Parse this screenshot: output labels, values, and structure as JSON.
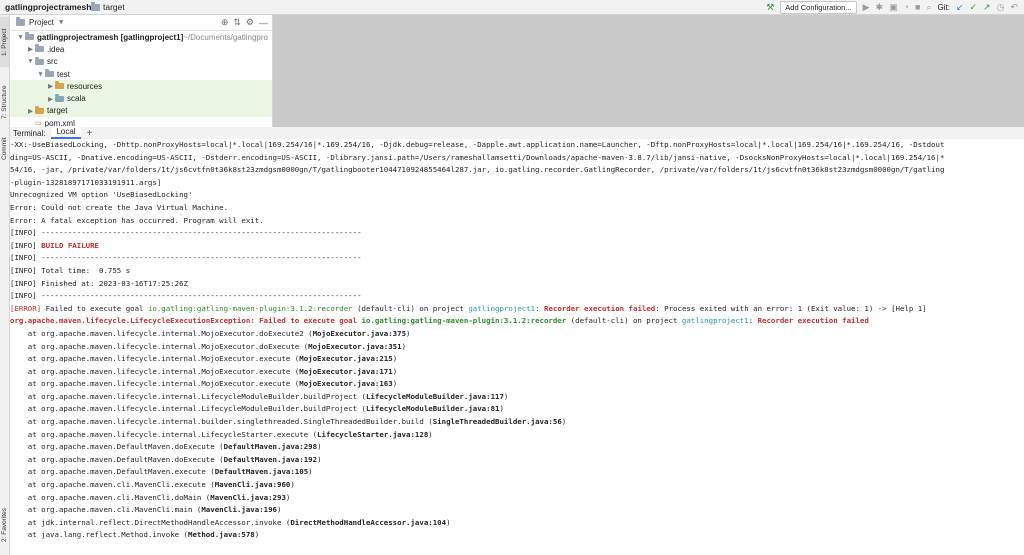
{
  "window": {
    "project_name": "gatlingprojectramesh",
    "breadcrumb_target": "target",
    "add_config_label": "Add Configuration...",
    "git_label": "Git:"
  },
  "left_strip": {
    "project_tab": "1: Project",
    "structure_tab": "7: Structure",
    "commit_tab": "Commit",
    "favorites_tab": "2: Favorites"
  },
  "project_panel": {
    "title": "Project",
    "tree": [
      {
        "label": "gatlingprojectramesh [gatlingproject1]",
        "suffix": " ~/Documents/gatlingpro",
        "indent": 0,
        "open": true,
        "kind": "gray"
      },
      {
        "label": ".idea",
        "indent": 1,
        "open": false,
        "kind": "gray"
      },
      {
        "label": "src",
        "indent": 1,
        "open": true,
        "kind": "gray"
      },
      {
        "label": "test",
        "indent": 2,
        "open": true,
        "kind": "gray"
      },
      {
        "label": "resources",
        "indent": 3,
        "open": false,
        "kind": "orange",
        "highlight": true
      },
      {
        "label": "scala",
        "indent": 3,
        "open": false,
        "kind": "teal",
        "highlight": true
      },
      {
        "label": "target",
        "indent": 1,
        "open": false,
        "kind": "orange",
        "highlight": true
      },
      {
        "label": "pom.xml",
        "indent": 1,
        "open": false,
        "kind": "none"
      }
    ]
  },
  "terminal": {
    "label": "Terminal:",
    "tab_local": "Local",
    "add_tab": "+",
    "lines": [
      {
        "text": "-XX:-UseBiasedLocking, -Dhttp.nonProxyHosts=local|*.local|169.254/16|*.169.254/16, -Djdk.debug=release, -Dapple.awt.application.name=Launcher, -Dftp.nonProxyHosts=local|*.local|169.254/16|*.169.254/16, -Dstdout"
      },
      {
        "text": "ding=US-ASCII, -Dnative.encoding=US-ASCII, -Dstderr.encoding=US-ASCII, -Dlibrary.jansi.path=/Users/rameshallamsetti/Downloads/apache-maven-3.8.7/lib/jansi-native, -DsocksNonProxyHosts=local|*.local|169.254/16|*"
      },
      {
        "text": "54/16, -jar, /private/var/folders/1t/js6cvtfn0t36k8st23zmdgsm0000gn/T/gatlingbooter1044710924855464l287.jar, io.gatling.recorder.GatlingRecorder, /private/var/folders/1t/js6cvtfn0t36k8st23zmdgsm0000gn/T/gatling"
      },
      {
        "text": "-plugin-13281897171033191911.args]"
      },
      {
        "text": "Unrecognized VM option 'UseBiasedLocking'"
      },
      {
        "text": "Error: Could not create the Java Virtual Machine."
      },
      {
        "text": "Error: A fatal exception has occurred. Program will exit."
      },
      {
        "text": "[INFO] ------------------------------------------------------------------------"
      },
      {
        "text": "[INFO] ",
        "extra": "BUILD FAILURE",
        "extra_class": "err bold"
      },
      {
        "text": "[INFO] ------------------------------------------------------------------------"
      },
      {
        "text": "[INFO] Total time:  0.755 s"
      },
      {
        "text": "[INFO] Finished at: 2023-03-16T17:25:26Z"
      },
      {
        "text": "[INFO] ------------------------------------------------------------------------"
      }
    ],
    "error_line": {
      "prefix": "[ERROR]",
      "p1": " Failed to execute goal ",
      "goal": "io.gatling:gatling-maven-plugin:3.1.2:recorder",
      "p2": " (default-cli) on project ",
      "project": "gatlingproject1",
      "p3": ": ",
      "reason": "Recorder execution failed",
      "p4": ": Process exited with an error: 1 (Exit value: 1) -> [Help 1]"
    },
    "exception_line": {
      "exception": "org.apache.maven.lifecycle.LifecycleExecutionException",
      "p1": ": Failed to execute goal ",
      "goal": "io.gatling:gatling-maven-plugin:3.1.2:recorder",
      "p2": " (default-cli) on project ",
      "project": "gatlingproject1",
      "p3": ": ",
      "reason": "Recorder execution failed"
    },
    "stack": [
      {
        "m": "org.apache.maven.lifecycle.internal.MojoExecutor.doExecute2",
        "f": "MojoExecutor.java:375"
      },
      {
        "m": "org.apache.maven.lifecycle.internal.MojoExecutor.doExecute",
        "f": "MojoExecutor.java:351"
      },
      {
        "m": "org.apache.maven.lifecycle.internal.MojoExecutor.execute",
        "f": "MojoExecutor.java:215"
      },
      {
        "m": "org.apache.maven.lifecycle.internal.MojoExecutor.execute",
        "f": "MojoExecutor.java:171"
      },
      {
        "m": "org.apache.maven.lifecycle.internal.MojoExecutor.execute",
        "f": "MojoExecutor.java:163"
      },
      {
        "m": "org.apache.maven.lifecycle.internal.LifecycleModuleBuilder.buildProject",
        "f": "LifecycleModuleBuilder.java:117"
      },
      {
        "m": "org.apache.maven.lifecycle.internal.LifecycleModuleBuilder.buildProject",
        "f": "LifecycleModuleBuilder.java:81"
      },
      {
        "m": "org.apache.maven.lifecycle.internal.builder.singlethreaded.SingleThreadedBuilder.build",
        "f": "SingleThreadedBuilder.java:56"
      },
      {
        "m": "org.apache.maven.lifecycle.internal.LifecycleStarter.execute",
        "f": "LifecycleStarter.java:128"
      },
      {
        "m": "org.apache.maven.DefaultMaven.doExecute",
        "f": "DefaultMaven.java:298"
      },
      {
        "m": "org.apache.maven.DefaultMaven.doExecute",
        "f": "DefaultMaven.java:192"
      },
      {
        "m": "org.apache.maven.DefaultMaven.execute",
        "f": "DefaultMaven.java:105"
      },
      {
        "m": "org.apache.maven.cli.MavenCli.execute",
        "f": "MavenCli.java:960"
      },
      {
        "m": "org.apache.maven.cli.MavenCli.doMain",
        "f": "MavenCli.java:293"
      },
      {
        "m": "org.apache.maven.cli.MavenCli.main",
        "f": "MavenCli.java:196"
      },
      {
        "m": "jdk.internal.reflect.DirectMethodHandleAccessor.invoke",
        "f": "DirectMethodHandleAccessor.java:104"
      },
      {
        "m": "java.lang.reflect.Method.invoke",
        "f": "Method.java:578"
      }
    ]
  }
}
